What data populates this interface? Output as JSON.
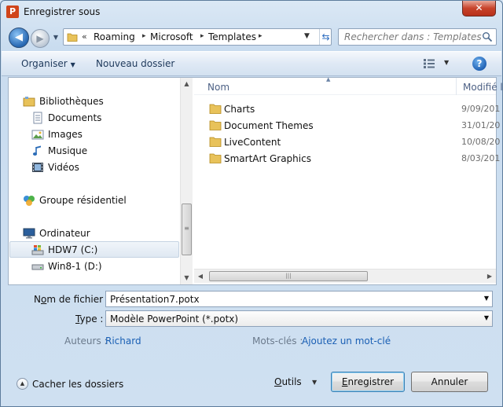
{
  "window": {
    "title": "Enregistrer sous",
    "app_icon_letter": "P",
    "close_glyph": "✕"
  },
  "address": {
    "overflow": "«",
    "crumbs": [
      "Roaming",
      "Microsoft",
      "Templates"
    ],
    "separator": "▸"
  },
  "search": {
    "placeholder": "Rechercher dans : Templates"
  },
  "toolbar": {
    "organize_label": "Organiser",
    "new_folder_label": "Nouveau dossier"
  },
  "nav": {
    "libraries": "Bibliothèques",
    "documents": "Documents",
    "images": "Images",
    "music": "Musique",
    "videos": "Vidéos",
    "homegroup": "Groupe résidentiel",
    "computer": "Ordinateur",
    "drive_c": "HDW7 (C:)",
    "drive_d": "Win8-1 (D:)"
  },
  "files": {
    "col_name": "Nom",
    "col_date": "Modifié l",
    "rows": [
      {
        "name": "Charts",
        "date": "9/09/201"
      },
      {
        "name": "Document Themes",
        "date": "31/01/20"
      },
      {
        "name": "LiveContent",
        "date": "10/08/20"
      },
      {
        "name": "SmartArt Graphics",
        "date": "8/03/201"
      }
    ]
  },
  "form": {
    "filename_label_pre": "N",
    "filename_label_u": "o",
    "filename_label_post": "m de fichier :",
    "filename_value": "Présentation7.potx",
    "type_label_u": "T",
    "type_label_post": "ype :",
    "type_value": "Modèle PowerPoint (*.potx)",
    "authors_label": "Auteurs :",
    "authors_value": "Richard",
    "keywords_label": "Mots-clés :",
    "keywords_value": "Ajoutez un mot-clé"
  },
  "footer": {
    "hide_folders": "Cacher les dossiers",
    "tools_u": "O",
    "tools_post": "utils",
    "save_u": "E",
    "save_post": "nregistrer",
    "cancel": "Annuler"
  }
}
